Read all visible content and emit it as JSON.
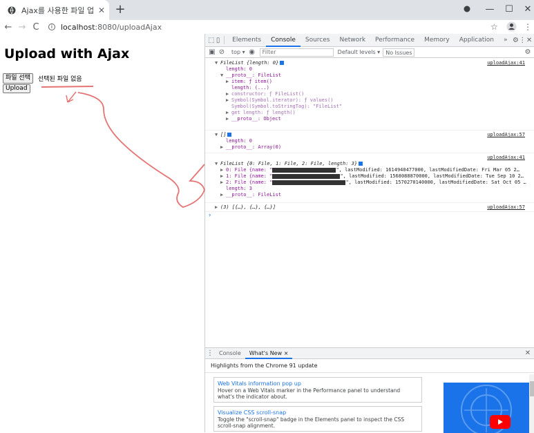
{
  "browser": {
    "tab_title": "Ajax를 사용한 파일 업로드",
    "url_host": "localhost",
    "url_rest": ":8080/uploadAjax"
  },
  "page": {
    "heading": "Upload with Ajax",
    "file_button": "파일 선택",
    "file_status": "선택된 파일 없음",
    "upload_button": "Upload"
  },
  "devtools": {
    "tabs": [
      "Elements",
      "Console",
      "Sources",
      "Network",
      "Performance",
      "Memory",
      "Application"
    ],
    "active_tab": "Console",
    "more": "»",
    "context": "top ▾",
    "filter_placeholder": "Filter",
    "levels": "Default levels ▾",
    "issues": "No Issues"
  },
  "console": {
    "entry1": {
      "source": "uploadAjax:41",
      "summary": "FileList {length: 0}",
      "lines": [
        "length: 0",
        "__proto__: FileList",
        "item: ƒ item()",
        "length: (...)",
        "constructor: ƒ FileList()",
        "Symbol(Symbol.iterator): ƒ values()",
        "Symbol(Symbol.toStringTag): \"FileList\"",
        "get length: ƒ length()",
        "__proto__: Object"
      ]
    },
    "entry2": {
      "source": "uploadAjax:57",
      "summary": "[]",
      "lines": [
        "length: 0",
        "__proto__: Array(0)"
      ]
    },
    "entry3": {
      "source": "uploadAjax:41",
      "summary": "FileList {0: File, 1: File, 2: File, length: 3}",
      "files": [
        {
          "key": "0: File {name: \"",
          "rest": "\", lastModified: 1614940477000, lastModifiedDate: Fri Mar 05 2…"
        },
        {
          "key": "1: File {name: \"",
          "rest": "\", lastModified: 1568088870000, lastModifiedDate: Tue Sep 10 2…"
        },
        {
          "key": "2: File {name: \"",
          "rest": "\", lastModified: 1570270140000, lastModifiedDate: Sat Oct 05 …"
        }
      ],
      "lines": [
        "length: 3",
        "__proto__: FileList"
      ]
    },
    "entry4": {
      "source": "uploadAjax:57",
      "summary": "(3) [{…}, {…}, {…}]"
    },
    "prompt": "›"
  },
  "drawer": {
    "tabs": [
      "Console",
      "What's New ×"
    ],
    "highlights": "Highlights from the Chrome 91 update",
    "cards": [
      {
        "title": "Web Vitals information pop up",
        "desc": "Hover on a Web Vitals marker in the Performance panel to understand what's the indicator about."
      },
      {
        "title": "Visualize CSS scroll-snap",
        "desc": "Toggle the \"scroll-snap\" badge in the Elements panel to inspect the CSS scroll-snap alignment."
      }
    ]
  },
  "colors": {
    "accent": "#1a73e8",
    "scribble": "#e57373"
  }
}
